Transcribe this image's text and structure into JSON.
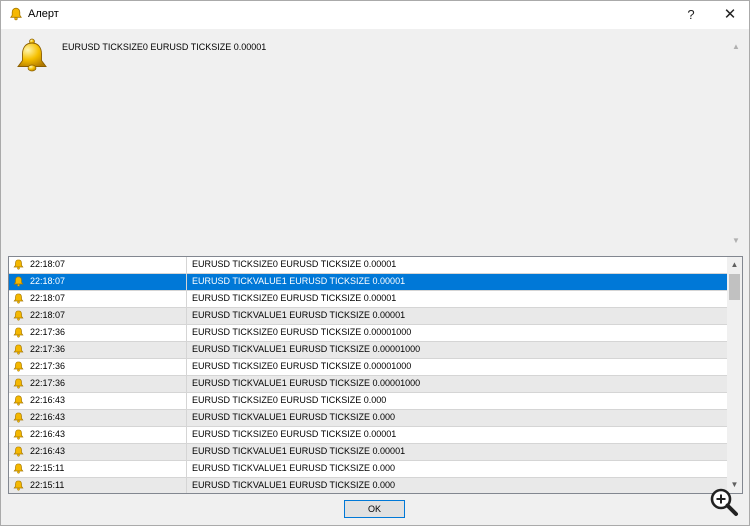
{
  "window": {
    "title": "Алерт",
    "help_label": "?",
    "close_label": "✕"
  },
  "alert": {
    "message": "EURUSD TICKSIZE0 EURUSD TICKSIZE 0.00001"
  },
  "rows": [
    {
      "time": "22:18:07",
      "message": "EURUSD TICKSIZE0 EURUSD TICKSIZE 0.00001"
    },
    {
      "time": "22:18:07",
      "message": "EURUSD TICKVALUE1 EURUSD TICKSIZE 0.00001",
      "selected": true
    },
    {
      "time": "22:18:07",
      "message": "EURUSD TICKSIZE0 EURUSD TICKSIZE 0.00001"
    },
    {
      "time": "22:18:07",
      "message": "EURUSD TICKVALUE1 EURUSD TICKSIZE 0.00001"
    },
    {
      "time": "22:17:36",
      "message": "EURUSD TICKSIZE0 EURUSD TICKSIZE 0.00001000"
    },
    {
      "time": "22:17:36",
      "message": "EURUSD TICKVALUE1 EURUSD TICKSIZE 0.00001000"
    },
    {
      "time": "22:17:36",
      "message": "EURUSD TICKSIZE0 EURUSD TICKSIZE 0.00001000"
    },
    {
      "time": "22:17:36",
      "message": "EURUSD TICKVALUE1 EURUSD TICKSIZE 0.00001000"
    },
    {
      "time": "22:16:43",
      "message": "EURUSD TICKSIZE0 EURUSD TICKSIZE 0.000"
    },
    {
      "time": "22:16:43",
      "message": "EURUSD TICKVALUE1 EURUSD TICKSIZE 0.000"
    },
    {
      "time": "22:16:43",
      "message": "EURUSD TICKSIZE0 EURUSD TICKSIZE 0.00001"
    },
    {
      "time": "22:16:43",
      "message": "EURUSD TICKVALUE1 EURUSD TICKSIZE 0.00001"
    },
    {
      "time": "22:15:11",
      "message": "EURUSD TICKVALUE1 EURUSD TICKSIZE 0.000"
    },
    {
      "time": "22:15:11",
      "message": "EURUSD TICKVALUE1 EURUSD TICKSIZE 0.000"
    }
  ],
  "buttons": {
    "ok_label": "OK"
  },
  "icons": {
    "title": "bell-icon",
    "alert": "bell-icon",
    "row": "bell-icon",
    "zoom": "zoom-in-icon"
  },
  "colors": {
    "selection": "#0078d7",
    "bell_gold": "#f5b800"
  }
}
